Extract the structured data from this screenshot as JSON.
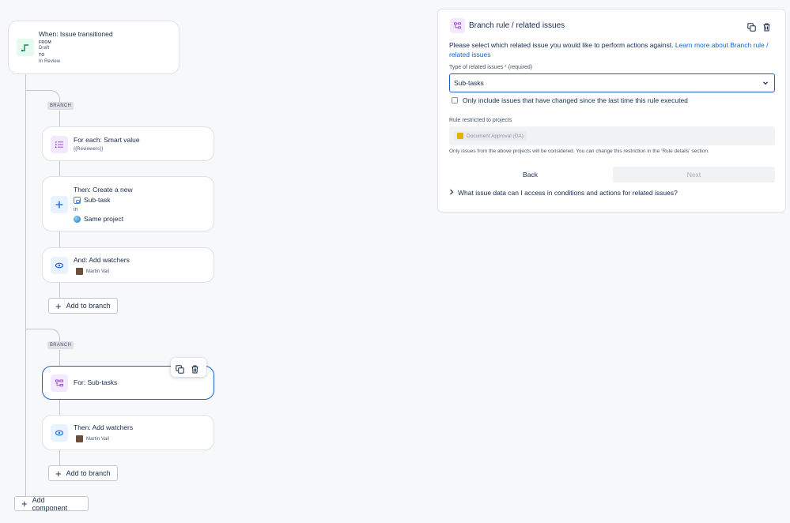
{
  "trigger": {
    "title": "When: Issue transitioned",
    "from_label": "FROM",
    "from_value": "Draft",
    "to_label": "TO",
    "to_value": "In Review"
  },
  "branch1": {
    "tag": "BRANCH",
    "foreach_title": "For each: Smart value",
    "foreach_value": "{{Reviewers}}",
    "create_title": "Then: Create a new",
    "create_type": "Sub-task",
    "create_in": "in",
    "create_project": "Same project",
    "watchers_title": "And: Add watchers",
    "watchers_user": "Martin Vail",
    "add_to_branch": "Add to branch"
  },
  "branch2": {
    "tag": "BRANCH",
    "for_title": "For: Sub-tasks",
    "watchers_title": "Then: Add watchers",
    "watchers_user": "Martin Vail",
    "add_to_branch": "Add to branch"
  },
  "add_component": "Add component",
  "panel": {
    "title": "Branch rule / related issues",
    "description": "Please select which related issue you would like to perform actions against.",
    "learn_more_link": "Learn more about Branch rule / related issues",
    "type_label": "Type of related issues",
    "required_marker": "*",
    "required_text": "(required)",
    "type_value": "Sub-tasks",
    "checkbox_label": "Only include issues that have changed since the last time this rule executed",
    "checkbox_checked": false,
    "restricted_label": "Rule restricted to projects",
    "project_chip": "Document Approval (DA)",
    "restricted_help": "Only issues from the above projects will be considered. You can change this restriction in the 'Rule details' section.",
    "back_button": "Back",
    "next_button": "Next",
    "expander": "What issue data can I access in conditions and actions for related issues?"
  },
  "colors": {
    "accent": "#1d5fd0",
    "link": "#0c66e4",
    "purple_icon": "#a44fd1",
    "green_icon": "#1f845a"
  }
}
